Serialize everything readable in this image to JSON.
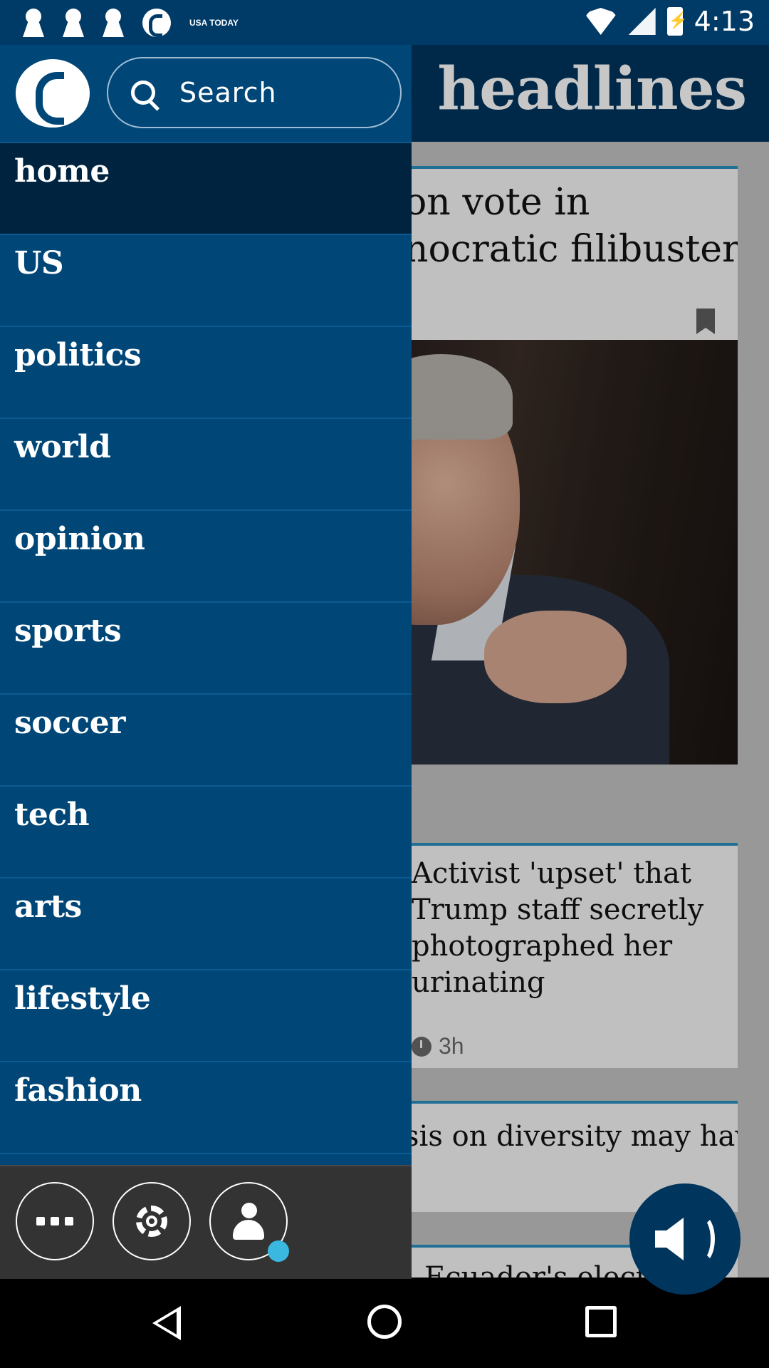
{
  "status_bar": {
    "time": "4:13",
    "usa_today": "USA TODAY",
    "icons": [
      "keyhole-icon",
      "keyhole-icon",
      "keyhole-icon",
      "guardian-icon",
      "wifi-icon",
      "cell-signal-icon",
      "battery-charging-icon"
    ]
  },
  "main": {
    "title": "headlines",
    "cards": [
      {
        "headline_line1": "on vote in",
        "headline_line2": "nocratic filibuster"
      },
      {
        "headline": "Activist 'upset' that Trump staff secretly photographed her urinating",
        "age": "3h"
      },
      {
        "headline": "sis on diversity may have"
      },
      {
        "headline": "Ecuador's election c"
      }
    ]
  },
  "drawer": {
    "search_placeholder": "Search",
    "items": [
      {
        "label": "home"
      },
      {
        "label": "US"
      },
      {
        "label": "politics"
      },
      {
        "label": "world"
      },
      {
        "label": "opinion"
      },
      {
        "label": "sports"
      },
      {
        "label": "soccer"
      },
      {
        "label": "tech"
      },
      {
        "label": "arts"
      },
      {
        "label": "lifestyle"
      },
      {
        "label": "fashion"
      }
    ],
    "active_item": "home"
  },
  "colors": {
    "drawer": "#004778",
    "active_item": "#00243f",
    "header": "#00355e",
    "accent_dot": "#3ab8e0",
    "footer": "#333333"
  }
}
